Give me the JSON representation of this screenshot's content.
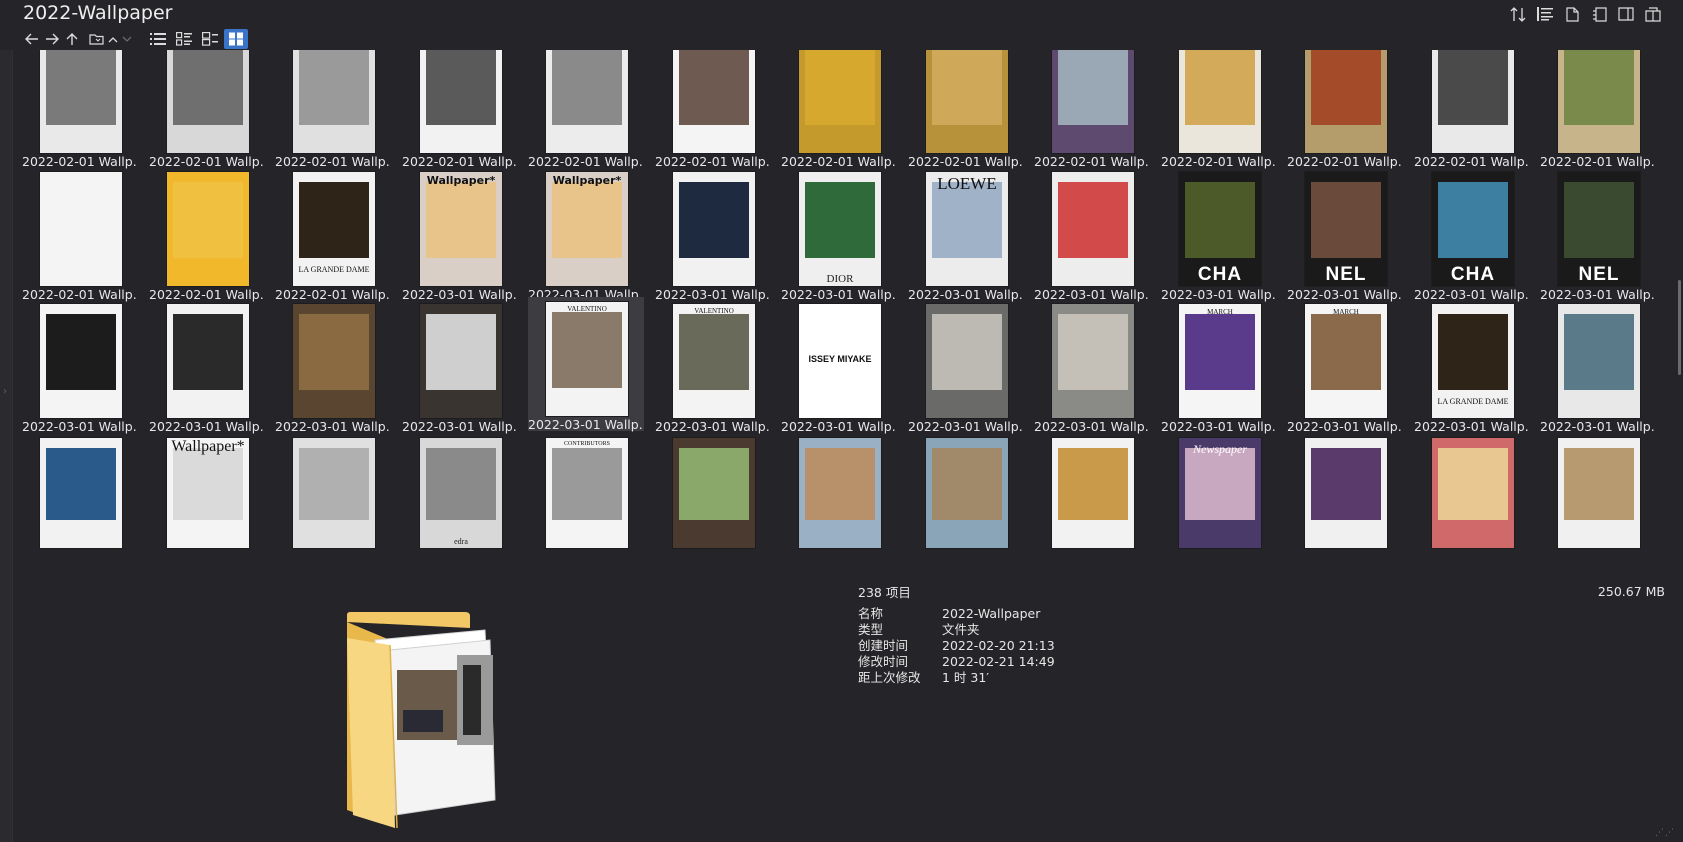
{
  "window": {
    "title": "2022-Wallpaper"
  },
  "toolbar": {
    "nav": [
      {
        "name": "back-icon",
        "glyph": "←"
      },
      {
        "name": "forward-icon",
        "glyph": "→"
      },
      {
        "name": "up-icon",
        "glyph": "↑"
      },
      {
        "name": "folder-nav-icon",
        "glyph": "🗀"
      },
      {
        "name": "chevron-up-icon",
        "glyph": "⌃"
      },
      {
        "name": "chevron-down-icon",
        "glyph": "⌄"
      }
    ],
    "views": [
      "list-view",
      "detail-view",
      "tile-view",
      "thumbnail-view"
    ],
    "active_view": "thumbnail-view",
    "right_icons": [
      "sort-icon",
      "group-icon",
      "document-icon",
      "page-icon",
      "preview-pane-icon",
      "dual-pane-icon"
    ]
  },
  "grid": {
    "rows": [
      {
        "items": [
          {
            "label": "2022-02-01 Wallp...",
            "style": "t-photo",
            "bg": "#e9e9e9",
            "ph": "#7a7a7a",
            "text": ""
          },
          {
            "label": "2022-02-01 Wallp...",
            "style": "t-photo",
            "bg": "#d8d8d8",
            "ph": "#6f6f6f",
            "text": ""
          },
          {
            "label": "2022-02-01 Wallp...",
            "style": "t-photo",
            "bg": "#e0e0e0",
            "ph": "#9a9a9a",
            "text": ""
          },
          {
            "label": "2022-02-01 Wallp...",
            "style": "t-photo",
            "bg": "#f2f2f2",
            "ph": "#5a5a5a",
            "text": ""
          },
          {
            "label": "2022-02-01 Wallp...",
            "style": "t-photo",
            "bg": "#ececec",
            "ph": "#8a8a8a",
            "text": ""
          },
          {
            "label": "2022-02-01 Wallp...",
            "style": "t-photo",
            "bg": "#f4f4f4",
            "ph": "#6e5a50",
            "text": ""
          },
          {
            "label": "2022-02-01 Wallp...",
            "style": "t-photo",
            "bg": "#c59a2c",
            "ph": "#d6a92e",
            "text": ""
          },
          {
            "label": "2022-02-01 Wallp...",
            "style": "t-photo",
            "bg": "#b8923b",
            "ph": "#cfa85a",
            "text": ""
          },
          {
            "label": "2022-02-01 Wallp...",
            "style": "t-photo",
            "bg": "#5d4a6e",
            "ph": "#9aa7b5",
            "text": ""
          },
          {
            "label": "2022-02-01 Wallp...",
            "style": "t-photo",
            "bg": "#eae6dc",
            "ph": "#d3a95a",
            "text": ""
          },
          {
            "label": "2022-02-01 Wallp...",
            "style": "t-photo",
            "bg": "#b49d6a",
            "ph": "#a44b2a",
            "text": ""
          },
          {
            "label": "2022-02-01 Wallp...",
            "style": "t-photo",
            "bg": "#e9e9e9",
            "ph": "#4a4a4a",
            "text": ""
          },
          {
            "label": "2022-02-01 Wallp...",
            "style": "t-photo",
            "bg": "#c8b48a",
            "ph": "#7a8a4a",
            "text": ""
          }
        ]
      },
      {
        "items": [
          {
            "label": "2022-02-01 Wallp...",
            "style": "t-photo",
            "bg": "#f4f4f4",
            "ph": "#f4f4f4",
            "text": ""
          },
          {
            "label": "2022-02-01 Wallp...",
            "style": "t-photo",
            "bg": "#f0b82a",
            "ph": "#f0c040",
            "text": ""
          },
          {
            "label": "2022-02-01 Wallp...",
            "style": "t-lgd",
            "bg": "#f2f2f2",
            "ph": "#2e2418",
            "text": "LA GRANDE DAME"
          },
          {
            "label": "2022-03-01 Wallp...",
            "style": "t-wall",
            "bg": "#d9cfc6",
            "ph": "#e8c48a",
            "text": "Wallpaper*"
          },
          {
            "label": "2022-03-01 Wallp...",
            "style": "t-wall",
            "bg": "#d9cfc6",
            "ph": "#e8c48a",
            "text": "Wallpaper*"
          },
          {
            "label": "2022-03-01 Wallp...",
            "style": "t-photo",
            "bg": "#f1f1f1",
            "ph": "#1e2a40",
            "text": ""
          },
          {
            "label": "2022-03-01 Wallp...",
            "style": "t-dior",
            "bg": "#efefef",
            "ph": "#2f6a3a",
            "text": "DIOR"
          },
          {
            "label": "2022-03-01 Wallp...",
            "style": "t-loewe",
            "bg": "#ececec",
            "ph": "#9fb2c8",
            "text": "LOEWE"
          },
          {
            "label": "2022-03-01 Wallp...",
            "style": "t-photo",
            "bg": "#ededed",
            "ph": "#d34a4a",
            "text": ""
          },
          {
            "label": "2022-03-01 Wallp...",
            "style": "t-cha",
            "bg": "#1a1a1a",
            "ph": "#4c5a2a",
            "text": "CHA"
          },
          {
            "label": "2022-03-01 Wallp...",
            "style": "t-nel",
            "bg": "#1a1a1a",
            "ph": "#6a4a3a",
            "text": "NEL"
          },
          {
            "label": "2022-03-01 Wallp...",
            "style": "t-cha",
            "bg": "#1a1a1a",
            "ph": "#3d7fa0",
            "text": "CHA"
          },
          {
            "label": "2022-03-01 Wallp...",
            "style": "t-nel",
            "bg": "#1a1a1a",
            "ph": "#3a4a30",
            "text": "NEL"
          }
        ]
      },
      {
        "items": [
          {
            "label": "2022-03-01 Wallp...",
            "style": "t-photo",
            "bg": "#f4f4f4",
            "ph": "#1c1c1c",
            "text": ""
          },
          {
            "label": "2022-03-01 Wallp...",
            "style": "t-photo",
            "bg": "#f2f2f2",
            "ph": "#2a2a2a",
            "text": ""
          },
          {
            "label": "2022-03-01 Wallp...",
            "style": "t-photo",
            "bg": "#5a4630",
            "ph": "#8a6a40",
            "text": ""
          },
          {
            "label": "2022-03-01 Wallp...",
            "style": "t-photo",
            "bg": "#3a3430",
            "ph": "#cfcfcf",
            "text": ""
          },
          {
            "label": "2022-03-01 Wallp...",
            "style": "t-val",
            "bg": "#f3f3f3",
            "ph": "#8a7a6a",
            "text": "VALENTINO"
          },
          {
            "label": "2022-03-01 Wallp...",
            "style": "t-val",
            "bg": "#f3f3f3",
            "ph": "#6a6a5a",
            "text": "VALENTINO"
          },
          {
            "label": "2022-03-01 Wallp...",
            "style": "t-issey",
            "bg": "#ffffff",
            "ph": "#ffffff",
            "text": "ISSEY MIYAKE"
          },
          {
            "label": "2022-03-01 Wallp...",
            "style": "t-photo",
            "bg": "#6a6a68",
            "ph": "#bdbab4",
            "text": ""
          },
          {
            "label": "2022-03-01 Wallp...",
            "style": "t-photo",
            "bg": "#8a8a86",
            "ph": "#c4c0b8",
            "text": ""
          },
          {
            "label": "2022-03-01 Wallp...",
            "style": "t-march",
            "bg": "#f5f5f5",
            "ph": "#5a3a8a",
            "text": "MARCH"
          },
          {
            "label": "2022-03-01 Wallp...",
            "style": "t-march",
            "bg": "#f5f5f5",
            "ph": "#8a6a4a",
            "text": "MARCH"
          },
          {
            "label": "2022-03-01 Wallp...",
            "style": "t-lgd",
            "bg": "#f2f2f2",
            "ph": "#2e2418",
            "text": "LA GRANDE DAME"
          },
          {
            "label": "2022-03-01 Wallp...",
            "style": "t-photo",
            "bg": "#e8e8e8",
            "ph": "#5a7a8a",
            "text": ""
          }
        ]
      },
      {
        "items": [
          {
            "label": "",
            "style": "t-photo",
            "bg": "#f2f2f2",
            "ph": "#2a5a8a",
            "text": ""
          },
          {
            "label": "",
            "style": "t-photo",
            "bg": "#f4f4f4",
            "ph": "#dadada",
            "text": "Wallpaper*"
          },
          {
            "label": "",
            "style": "t-photo",
            "bg": "#e0e0e0",
            "ph": "#b0b0b0",
            "text": ""
          },
          {
            "label": "",
            "style": "t-edra",
            "bg": "#d8d8d8",
            "ph": "#8a8a8a",
            "text": "edra"
          },
          {
            "label": "",
            "style": "t-contr",
            "bg": "#f4f4f4",
            "ph": "#9a9a9a",
            "text": "CONTRIBUTORS"
          },
          {
            "label": "",
            "style": "t-photo",
            "bg": "#4a3a30",
            "ph": "#8aa86a",
            "text": ""
          },
          {
            "label": "",
            "style": "t-photo",
            "bg": "#9ab0c4",
            "ph": "#b8906a",
            "text": ""
          },
          {
            "label": "",
            "style": "t-photo",
            "bg": "#8aa4b8",
            "ph": "#a08a6a",
            "text": ""
          },
          {
            "label": "",
            "style": "t-photo",
            "bg": "#f2f2f2",
            "ph": "#c89a4a",
            "text": ""
          },
          {
            "label": "",
            "style": "t-news",
            "bg": "#4a3a6a",
            "ph": "#c8a8c0",
            "text": "Newspaper"
          },
          {
            "label": "",
            "style": "t-photo",
            "bg": "#f0f0f0",
            "ph": "#5a3a6a",
            "text": ""
          },
          {
            "label": "",
            "style": "t-photo",
            "bg": "#d06a6a",
            "ph": "#e8c890",
            "text": ""
          },
          {
            "label": "",
            "style": "t-photo",
            "bg": "#f0f0f0",
            "ph": "#b89a70",
            "text": ""
          }
        ]
      }
    ]
  },
  "status": {
    "count": "238 项目",
    "size": "250.67 MB"
  },
  "properties": [
    {
      "key": "名称",
      "value": "2022-Wallpaper"
    },
    {
      "key": "类型",
      "value": "文件夹"
    },
    {
      "key": "创建时间",
      "value": "2022-02-20  21:13"
    },
    {
      "key": "修改时间",
      "value": "2022-02-21  14:49"
    },
    {
      "key": "距上次修改",
      "value": "1 时 31′"
    }
  ],
  "colors": {
    "background": "#252529",
    "accent": "#3a74c9",
    "folder": "#f2c766"
  }
}
